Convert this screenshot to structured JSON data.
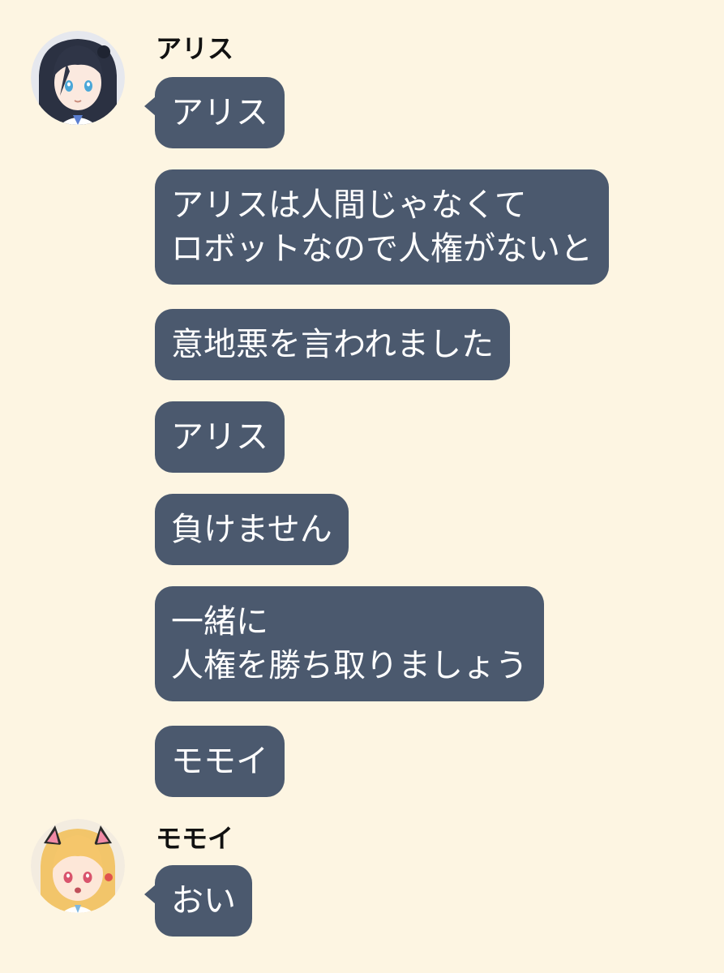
{
  "chat": {
    "background_color": "#fdf5e2",
    "bubble_color": "#4b596e",
    "bubble_text_color": "#ffffff",
    "groups": [
      {
        "sender": "アリス",
        "avatar_icon": "aris-avatar-icon",
        "messages": [
          "アリス",
          "アリスは人間じゃなくて\nロボットなので人権がないと",
          "意地悪を言われました",
          "アリス",
          "負けません",
          "一緒に\n人権を勝ち取りましょう",
          "モモイ"
        ]
      },
      {
        "sender": "モモイ",
        "avatar_icon": "momoi-avatar-icon",
        "messages": [
          "おい"
        ]
      }
    ]
  }
}
